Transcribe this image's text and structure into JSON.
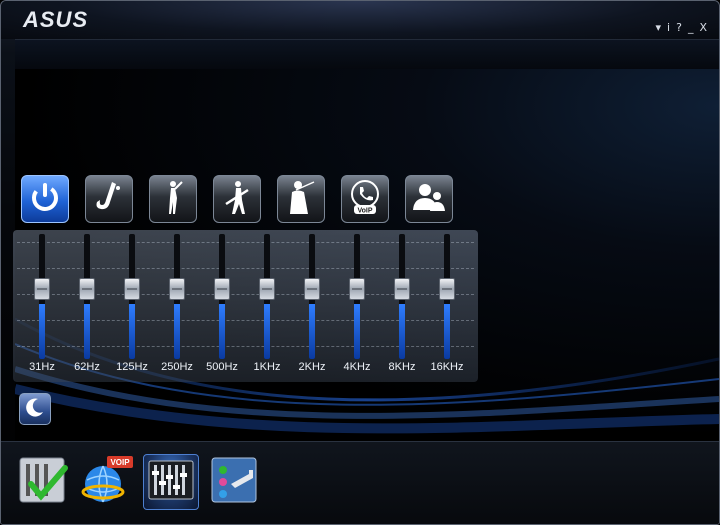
{
  "app": {
    "logo": "ASUS"
  },
  "window_controls": {
    "menu": "▾",
    "info": "i",
    "help": "?",
    "minimize": "_",
    "close": "X"
  },
  "presets": [
    {
      "name": "power",
      "icon": "power-icon",
      "active": true
    },
    {
      "name": "jazz",
      "icon": "saxophone-icon",
      "active": false
    },
    {
      "name": "pop",
      "icon": "dancer-icon",
      "active": false
    },
    {
      "name": "rock",
      "icon": "guitarist-icon",
      "active": false
    },
    {
      "name": "classical",
      "icon": "violinist-icon",
      "active": false
    },
    {
      "name": "voip",
      "icon": "voip-phone-icon",
      "label": "VoIP",
      "active": false
    },
    {
      "name": "user",
      "icon": "user-group-icon",
      "active": false
    }
  ],
  "equalizer": {
    "bands": [
      {
        "label": "31Hz",
        "level": 0.5
      },
      {
        "label": "62Hz",
        "level": 0.5
      },
      {
        "label": "125Hz",
        "level": 0.5
      },
      {
        "label": "250Hz",
        "level": 0.5
      },
      {
        "label": "500Hz",
        "level": 0.5
      },
      {
        "label": "1KHz",
        "level": 0.5
      },
      {
        "label": "2KHz",
        "level": 0.5
      },
      {
        "label": "4KHz",
        "level": 0.5
      },
      {
        "label": "8KHz",
        "level": 0.5
      },
      {
        "label": "16KHz",
        "level": 0.5
      }
    ]
  },
  "night_mode": {
    "icon": "moon-icon"
  },
  "bottom_tabs": [
    {
      "name": "system-tab",
      "icon": "equalizer-check-icon",
      "selected": false
    },
    {
      "name": "voip-tab",
      "icon": "voip-globe-icon",
      "label": "VOIP",
      "selected": false
    },
    {
      "name": "equalizer-tab",
      "icon": "mixer-sliders-icon",
      "selected": true
    },
    {
      "name": "device-tab",
      "icon": "audio-jack-icon",
      "selected": false
    }
  ],
  "colors": {
    "accent": "#1f63d6",
    "background": "#000000",
    "text": "#eef2f8"
  }
}
